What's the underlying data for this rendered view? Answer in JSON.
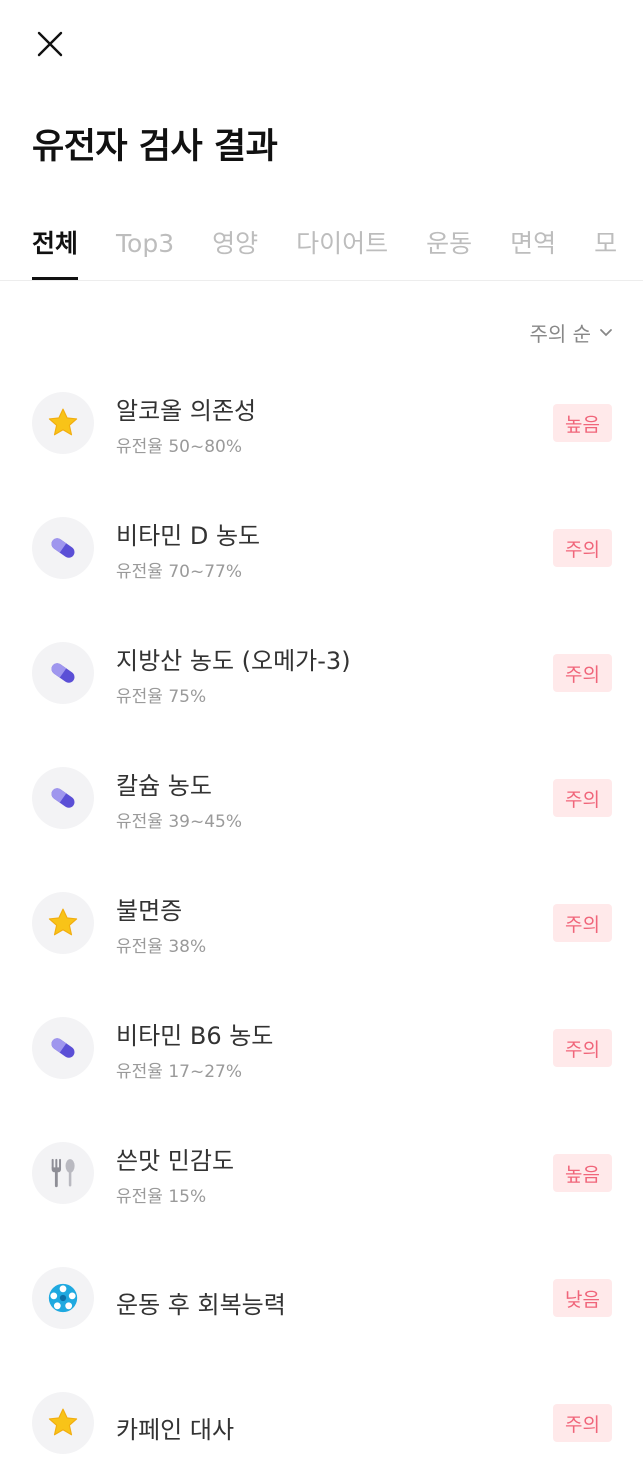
{
  "page": {
    "title": "유전자 검사 결과"
  },
  "tabs": [
    {
      "label": "전체",
      "active": true
    },
    {
      "label": "Top3",
      "active": false
    },
    {
      "label": "영양",
      "active": false
    },
    {
      "label": "다이어트",
      "active": false
    },
    {
      "label": "운동",
      "active": false
    },
    {
      "label": "면역",
      "active": false
    },
    {
      "label": "모",
      "active": false
    }
  ],
  "sort": {
    "label": "주의 순"
  },
  "items": [
    {
      "name": "알코올 의존성",
      "sub": "유전율 50~80%",
      "badge": "높음",
      "icon": "star-icon"
    },
    {
      "name": "비타민 D 농도",
      "sub": "유전율 70~77%",
      "badge": "주의",
      "icon": "pill-icon"
    },
    {
      "name": "지방산 농도 (오메가-3)",
      "sub": "유전율 75%",
      "badge": "주의",
      "icon": "pill-icon"
    },
    {
      "name": "칼슘 농도",
      "sub": "유전율 39~45%",
      "badge": "주의",
      "icon": "pill-icon"
    },
    {
      "name": "불면증",
      "sub": "유전율 38%",
      "badge": "주의",
      "icon": "star-icon"
    },
    {
      "name": "비타민 B6 농도",
      "sub": "유전율 17~27%",
      "badge": "주의",
      "icon": "pill-icon"
    },
    {
      "name": "쓴맛 민감도",
      "sub": "유전율 15%",
      "badge": "높음",
      "icon": "utensils-icon"
    },
    {
      "name": "운동 후 회복능력",
      "sub": "",
      "badge": "낮음",
      "icon": "soccer-ball-icon"
    },
    {
      "name": "카페인 대사",
      "sub": "",
      "badge": "주의",
      "icon": "star-icon"
    }
  ],
  "colors": {
    "badge_bg": "#ffe9ea",
    "badge_text": "#f0657a",
    "pill": "#5b4fd6",
    "star": "#f8c318",
    "ball": "#1fa9e0"
  }
}
